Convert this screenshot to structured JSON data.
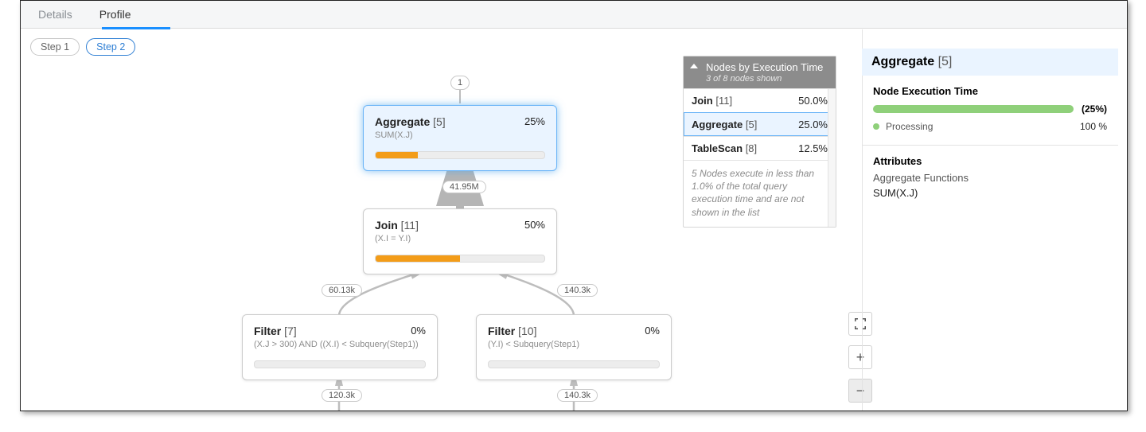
{
  "tabs": {
    "details": "Details",
    "profile": "Profile",
    "active": "profile"
  },
  "steps": {
    "step1": "Step 1",
    "step2": "Step 2",
    "active": "step2"
  },
  "canvas": {
    "root_badge": "1",
    "edges": {
      "e_agg_join": "41.95M",
      "e_join_filter7": "60.13k",
      "e_join_filter10": "140.3k",
      "e_filter7_src": "120.3k",
      "e_filter10_src": "140.3k"
    },
    "nodes": {
      "aggregate": {
        "name": "Aggregate",
        "idx": "[5]",
        "pct": "25%",
        "subtitle": "SUM(X.J)",
        "fill_pct": 25
      },
      "join": {
        "name": "Join",
        "idx": "[11]",
        "pct": "50%",
        "subtitle": "(X.I = Y.I)",
        "fill_pct": 50
      },
      "filter7": {
        "name": "Filter",
        "idx": "[7]",
        "pct": "0%",
        "subtitle": "(X.J > 300) AND ((X.I) < Subquery(Step1))",
        "fill_pct": 0
      },
      "filter10": {
        "name": "Filter",
        "idx": "[10]",
        "pct": "0%",
        "subtitle": "(Y.I) < Subquery(Step1)",
        "fill_pct": 0
      }
    }
  },
  "nodes_panel": {
    "title": "Nodes by Execution Time",
    "subtitle": "3 of 8 nodes shown",
    "rows": [
      {
        "name": "Join",
        "idx": "[11]",
        "pct": "50.0%",
        "selected": false
      },
      {
        "name": "Aggregate",
        "idx": "[5]",
        "pct": "25.0%",
        "selected": true
      },
      {
        "name": "TableScan",
        "idx": "[8]",
        "pct": "12.5%",
        "selected": false
      }
    ],
    "footnote": "5 Nodes execute in less than 1.0% of the total query execution time and are not shown in the list"
  },
  "detail": {
    "title_name": "Aggregate",
    "title_idx": "[5]",
    "exec_label": "Node Execution Time",
    "exec_pct": "(25%)",
    "legend_processing_label": "Processing",
    "legend_processing_value": "100 %",
    "attributes_heading": "Attributes",
    "agg_fn_label": "Aggregate Functions",
    "agg_fn_value": "SUM(X.J)"
  },
  "colors": {
    "accent": "#1a8fff",
    "bar_orange": "#f39c18",
    "bar_green": "#8fd07a",
    "sel_bg": "#eaf4ff",
    "sel_border": "#6ab4f7"
  }
}
